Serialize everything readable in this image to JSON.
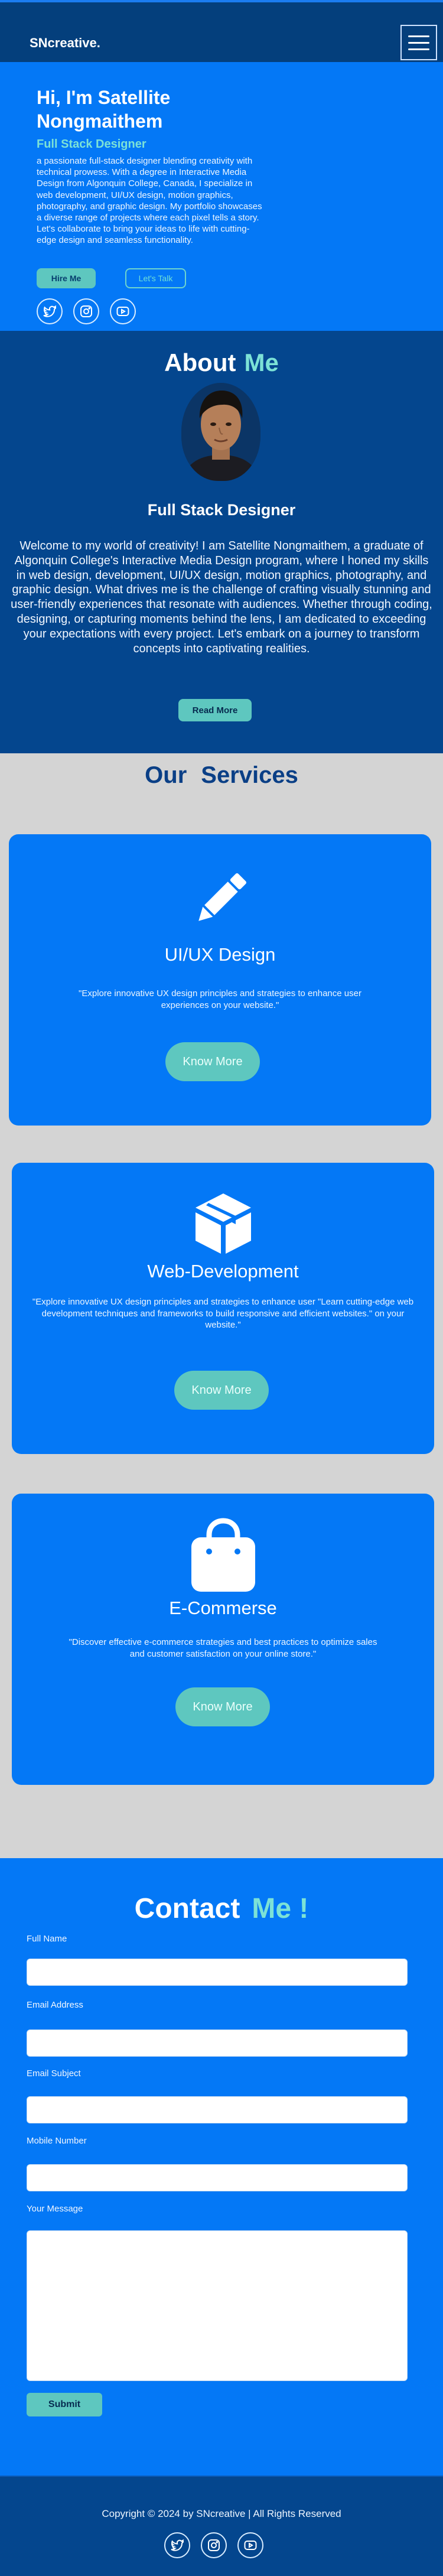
{
  "header": {
    "logo": "SNcreative.",
    "menu_icon": "hamburger-menu-icon"
  },
  "hero": {
    "greeting": "Hi, I'm Satellite Nongmaithem",
    "role": "Full Stack Designer",
    "description": "a passionate full-stack designer blending creativity with technical prowess. With a degree in Interactive Media Design from Algonquin College, Canada, I specialize in web development, UI/UX design, motion graphics, photography, and graphic design. My portfolio showcases a diverse range of projects where each pixel tells a story. Let's collaborate to bring your ideas to life with cutting-edge design and seamless functionality.",
    "hire_label": "Hire Me",
    "talk_label": "Let's Talk",
    "social_icons": [
      "twitter-icon",
      "instagram-icon",
      "youtube-icon"
    ]
  },
  "about": {
    "title_main": "About",
    "title_accent": "Me",
    "role": "Full Stack Designer",
    "text": "Welcome to my world of creativity! I am Satellite Nongmaithem, a graduate of Algonquin College's Interactive Media Design program, where I honed my skills in web design, development, UI/UX design, motion graphics, photography, and graphic design. What drives me is the challenge of crafting visually stunning and user-friendly experiences that resonate with audiences. Whether through coding, designing, or capturing moments behind the lens, I am dedicated to exceeding your expectations with every project. Let's embark on a journey to transform concepts into captivating realities.",
    "read_more_label": "Read More"
  },
  "services": {
    "title_main": "Our",
    "title_accent": "Services",
    "items": [
      {
        "icon": "pencil-icon",
        "title": "UI/UX Design",
        "description": "\"Explore innovative UX design principles and strategies to enhance user experiences on your website.\"",
        "button": "Know More"
      },
      {
        "icon": "cube-icon",
        "title": "Web-Development",
        "description": "\"Explore innovative UX design principles and strategies to enhance user \"Learn cutting-edge web development techniques and frameworks to build responsive and efficient websites.\" on your website.\"",
        "button": "Know More"
      },
      {
        "icon": "shopping-bag-icon",
        "title": "E-Commerse",
        "description": "\"Discover effective e-commerce strategies and best practices to optimize sales and customer satisfaction on your online store.\"",
        "button": "Know More"
      }
    ]
  },
  "contact": {
    "title_main": "Contact",
    "title_accent": "Me !",
    "fields": {
      "full_name": "Full Name",
      "email": "Email Address",
      "subject": "Email Subject",
      "mobile": "Mobile Number",
      "message": "Your Message"
    },
    "submit_label": "Submit"
  },
  "footer": {
    "copyright": "Copyright © 2024 by SNcreative | All Rights Reserved",
    "social_icons": [
      "twitter-icon",
      "instagram-icon",
      "youtube-icon"
    ]
  },
  "colors": {
    "primary_blue": "#0478f6",
    "dark_blue": "#04468e",
    "accent_teal": "#5ec7bf"
  }
}
